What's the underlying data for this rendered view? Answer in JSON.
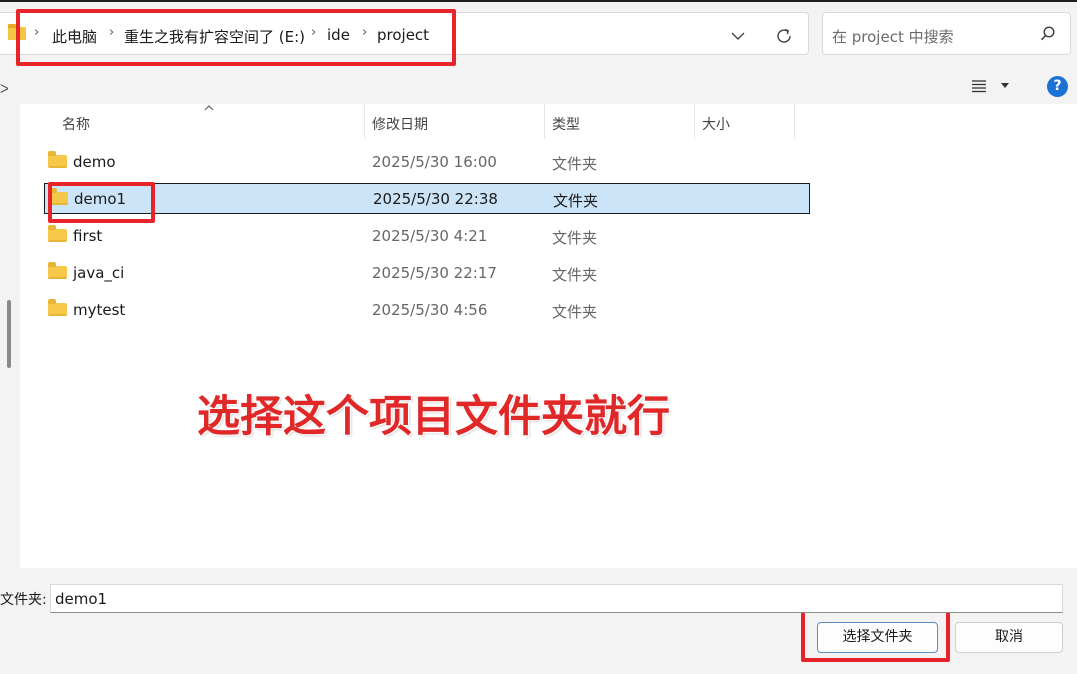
{
  "breadcrumb": {
    "items": [
      "此电脑",
      "重生之我有扩容空间了 (E:)",
      "ide",
      "project"
    ],
    "separator": "›"
  },
  "search": {
    "placeholder": "在 project 中搜索"
  },
  "icons": {
    "breadcrumb_folder": "folder-icon",
    "dropdown": "chevron-down-icon",
    "refresh": "refresh-icon",
    "search": "search-icon",
    "view": "list-view-icon",
    "help": "help-icon",
    "sort": "sort-ascending-icon"
  },
  "toolbar": {
    "help_label": "?"
  },
  "columns": {
    "name": "名称",
    "modified": "修改日期",
    "type": "类型",
    "size": "大小"
  },
  "files": [
    {
      "name": "demo",
      "modified": "2025/5/30 16:00",
      "type": "文件夹",
      "selected": false
    },
    {
      "name": "demo1",
      "modified": "2025/5/30 22:38",
      "type": "文件夹",
      "selected": true
    },
    {
      "name": "first",
      "modified": "2025/5/30 4:21",
      "type": "文件夹",
      "selected": false
    },
    {
      "name": "java_ci",
      "modified": "2025/5/30 22:17",
      "type": "文件夹",
      "selected": false
    },
    {
      "name": "mytest",
      "modified": "2025/5/30 4:56",
      "type": "文件夹",
      "selected": false
    }
  ],
  "annotation": {
    "text": "选择这个项目文件夹就行",
    "color": "#e02828"
  },
  "footer": {
    "folder_label": "文件夹:",
    "folder_value": "demo1",
    "select_button": "选择文件夹",
    "cancel_button": "取消"
  },
  "colors": {
    "selection": "#cce4f7",
    "highlight_box": "#e8242b",
    "help_badge": "#1c72d4",
    "folder": "#f6c84a"
  }
}
